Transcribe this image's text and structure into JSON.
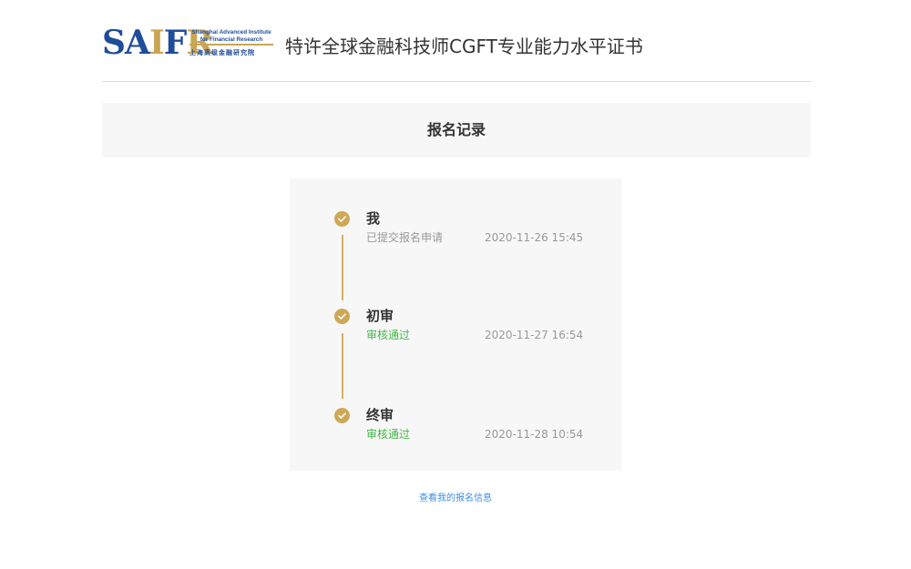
{
  "header": {
    "logo_letters": [
      "S",
      "A",
      "I",
      "F",
      "R"
    ],
    "logo_en_line1": "Shanghai Advanced Institute",
    "logo_en_line2": "for Financial Research",
    "logo_cn": "上海高级金融研究院",
    "title": "特许全球金融科技师CGFT专业能力水平证书"
  },
  "section": {
    "title": "报名记录"
  },
  "timeline": {
    "steps": [
      {
        "name": "我",
        "status": "已提交报名申请",
        "time": "2020-11-26 15:45",
        "status_color": "#999999"
      },
      {
        "name": "初审",
        "status": "审核通过",
        "time": "2020-11-27 16:54",
        "status_color": "#44b549"
      },
      {
        "name": "终审",
        "status": "审核通过",
        "time": "2020-11-28 10:54",
        "status_color": "#44b549"
      }
    ]
  },
  "footer": {
    "link_label": "查看我的报名信息"
  },
  "colors": {
    "accent_gold": "#cfa857",
    "brand_blue": "#1f4d9b",
    "link_blue": "#3a8ee6",
    "success_green": "#44b549"
  },
  "icons": {
    "step_icon": "check-circle-icon"
  }
}
